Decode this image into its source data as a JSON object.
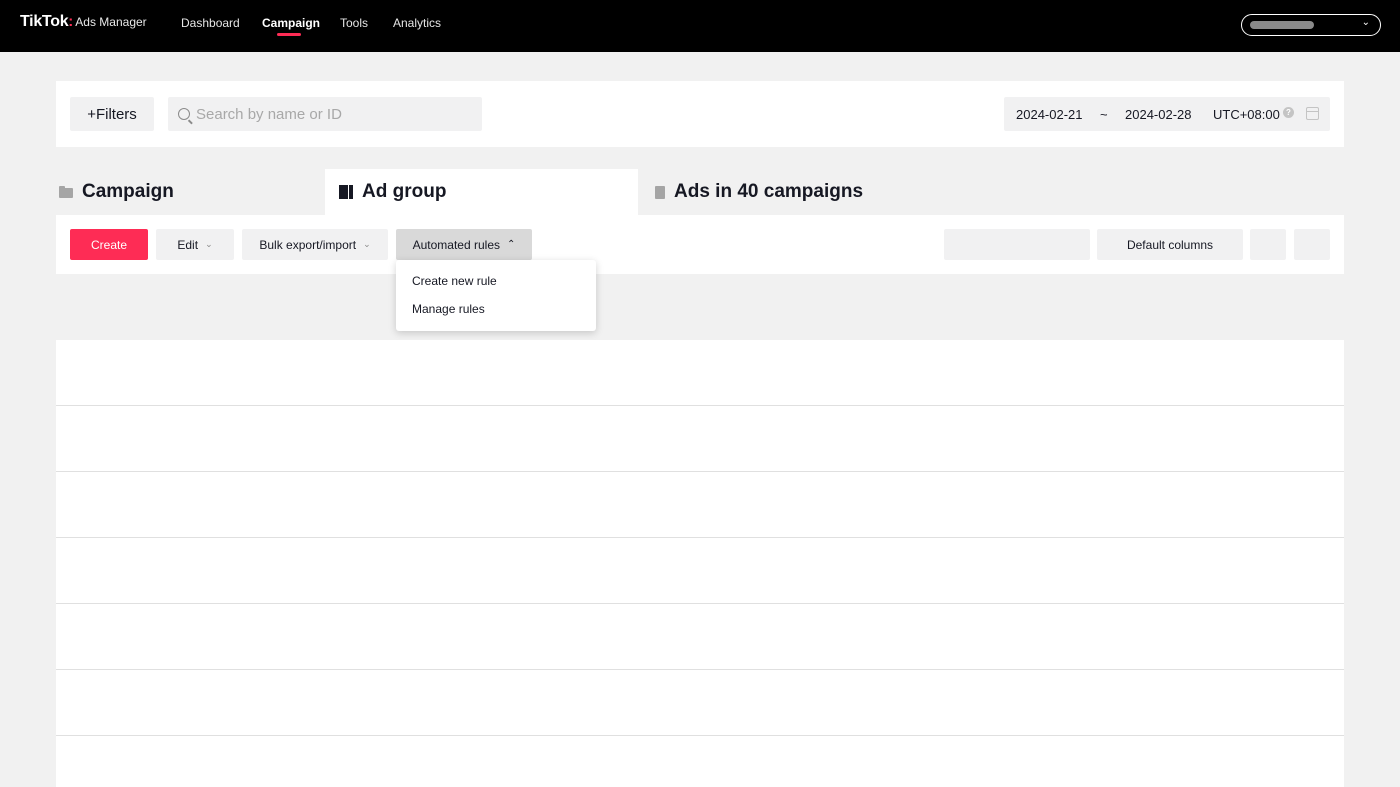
{
  "topbar": {
    "logo": "TikTok",
    "logo_separator": ":",
    "logo_sub": "Ads Manager",
    "nav": [
      "Dashboard",
      "Campaign",
      "Tools",
      "Analytics"
    ],
    "active_nav": "Campaign",
    "accent_color": "#fe2c55"
  },
  "filters": {
    "filters_label": "+Filters",
    "search_placeholder": "Search by name or ID",
    "date_start": "2024-02-21",
    "date_separator": "~",
    "date_end": "2024-02-28",
    "timezone": "UTC+08:00"
  },
  "tabs": {
    "campaign": "Campaign",
    "ad_group": "Ad group",
    "ads": "Ads in 40 campaigns",
    "active": "Ad group"
  },
  "toolbar": {
    "create": "Create",
    "edit": "Edit",
    "bulk": "Bulk export/import",
    "automated_rules": "Automated rules",
    "default_columns": "Default columns"
  },
  "automated_rules_menu": [
    "Create new rule",
    "Manage rules"
  ],
  "icons": [
    "search-icon",
    "help-icon",
    "calendar-icon",
    "folder-icon",
    "ad-group-icon",
    "ad-icon",
    "chevron-down-icon",
    "chevron-up-icon"
  ]
}
